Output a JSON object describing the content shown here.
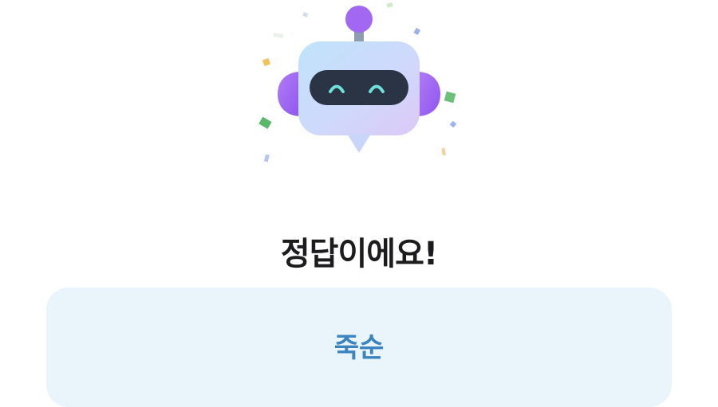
{
  "result": {
    "title": "정답이에요!",
    "answer_label": "죽순"
  },
  "illustration": {
    "icon": "robot-mascot-icon",
    "decorations": "confetti"
  },
  "colors": {
    "background": "#ffffff",
    "title": "#1c1c1e",
    "answer_card_bg": "#e9f4fb",
    "answer_text": "#3b84bf",
    "robot_accent": "#a368f2",
    "robot_face": "#2b3445",
    "robot_eyes": "#6fe0da"
  }
}
